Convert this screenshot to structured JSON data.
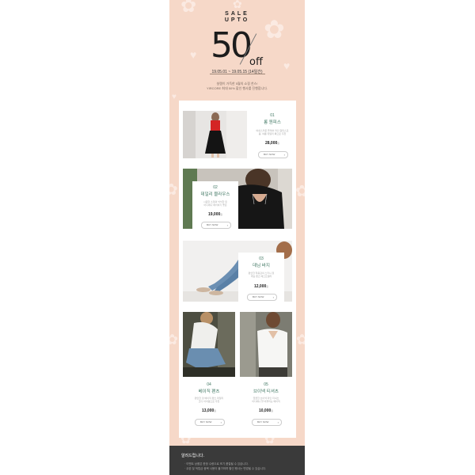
{
  "header": {
    "sale_line": "SALE",
    "upto_line": "UPTO",
    "big_number": "50",
    "off_word": "off",
    "dates": "19.05.01 ~ 19.05.15 (14일간)",
    "desc_line1": "설렘이 가득한 5월의 쇼핑 찬스!",
    "desc_line2": "YIRCORE 최대 50% 할인 행사를 진행합니다."
  },
  "products": [
    {
      "num": "01",
      "title": "롱 원피스",
      "desc1": "여성스러운 플레어 라인 원피스로",
      "desc2": "봄, 여름 데일리 룩으로 추천",
      "price": "28,000",
      "won": "원",
      "buy": "BUY NOW"
    },
    {
      "num": "02",
      "title": "데일리 블라우스",
      "desc1": "시원한 소재의 넉넉한 핏",
      "desc2": "어디에나 매치하기 좋은",
      "price": "19,000",
      "won": "원",
      "buy": "BUY NOW"
    },
    {
      "num": "03",
      "title": "데님 바지",
      "desc1": "편안한 착용감의 스키니 핏",
      "desc2": "데님 팬츠 베스트셀러",
      "price": "12,000",
      "won": "원",
      "buy": "BUY NOW"
    },
    {
      "num": "04",
      "title": "베이직 팬츠",
      "desc1": "편안한 핏 베이직 팬츠 데일리",
      "desc2": "코디 아이템으로 추천",
      "price": "13,000",
      "won": "원",
      "buy": "BUY NOW"
    },
    {
      "num": "05",
      "title": "브이넥 티셔츠",
      "desc1": "깔끔한 브이넥 라인 티셔츠",
      "desc2": "어디에나 잘 어울리는 베이직",
      "price": "10,000",
      "won": "원",
      "buy": "BUY NOW"
    }
  ],
  "footer": {
    "title": "알려드립니다.",
    "note1": "· 이벤트 상품은 한정 수량으로 조기 품절될 수 있습니다.",
    "note2": "· 쿠폰 및 적립금 중복 사용이 불가하며 할인 행사는 변경될 수 있습니다."
  },
  "colors": {
    "banner_bg": "#f6d8c8",
    "accent_green": "#3d7560",
    "footer_bg": "#3a3a3a"
  }
}
